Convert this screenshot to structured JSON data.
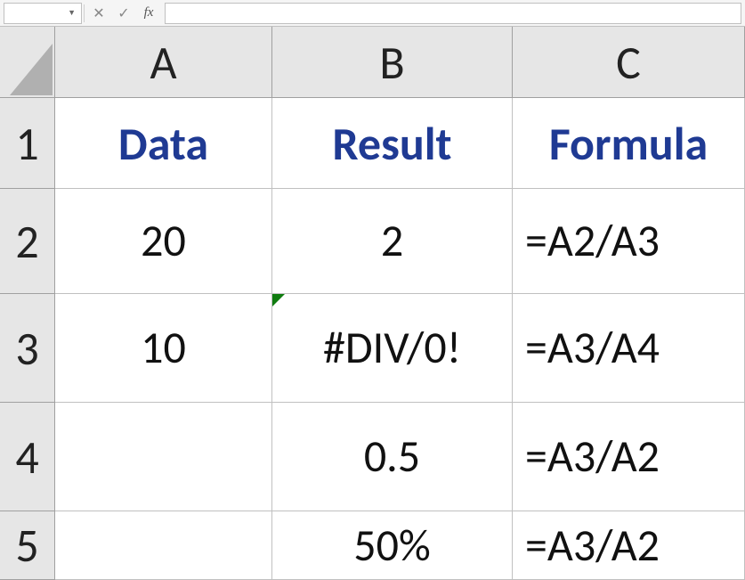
{
  "formula_bar": {
    "name_box_value": "",
    "fx_label": "fx",
    "formula_value": ""
  },
  "columns": [
    "A",
    "B",
    "C"
  ],
  "row_numbers": [
    "1",
    "2",
    "3",
    "4",
    "5"
  ],
  "headers": {
    "A": "Data",
    "B": "Result",
    "C": "Formula"
  },
  "rows": [
    {
      "A": "20",
      "B": "2",
      "C": "=A2/A3"
    },
    {
      "A": "10",
      "B": "#DIV/0!",
      "C": "=A3/A4"
    },
    {
      "A": "",
      "B": "0.5",
      "C": "=A3/A2"
    },
    {
      "A": "",
      "B": "50%",
      "C": "=A3/A2"
    }
  ]
}
